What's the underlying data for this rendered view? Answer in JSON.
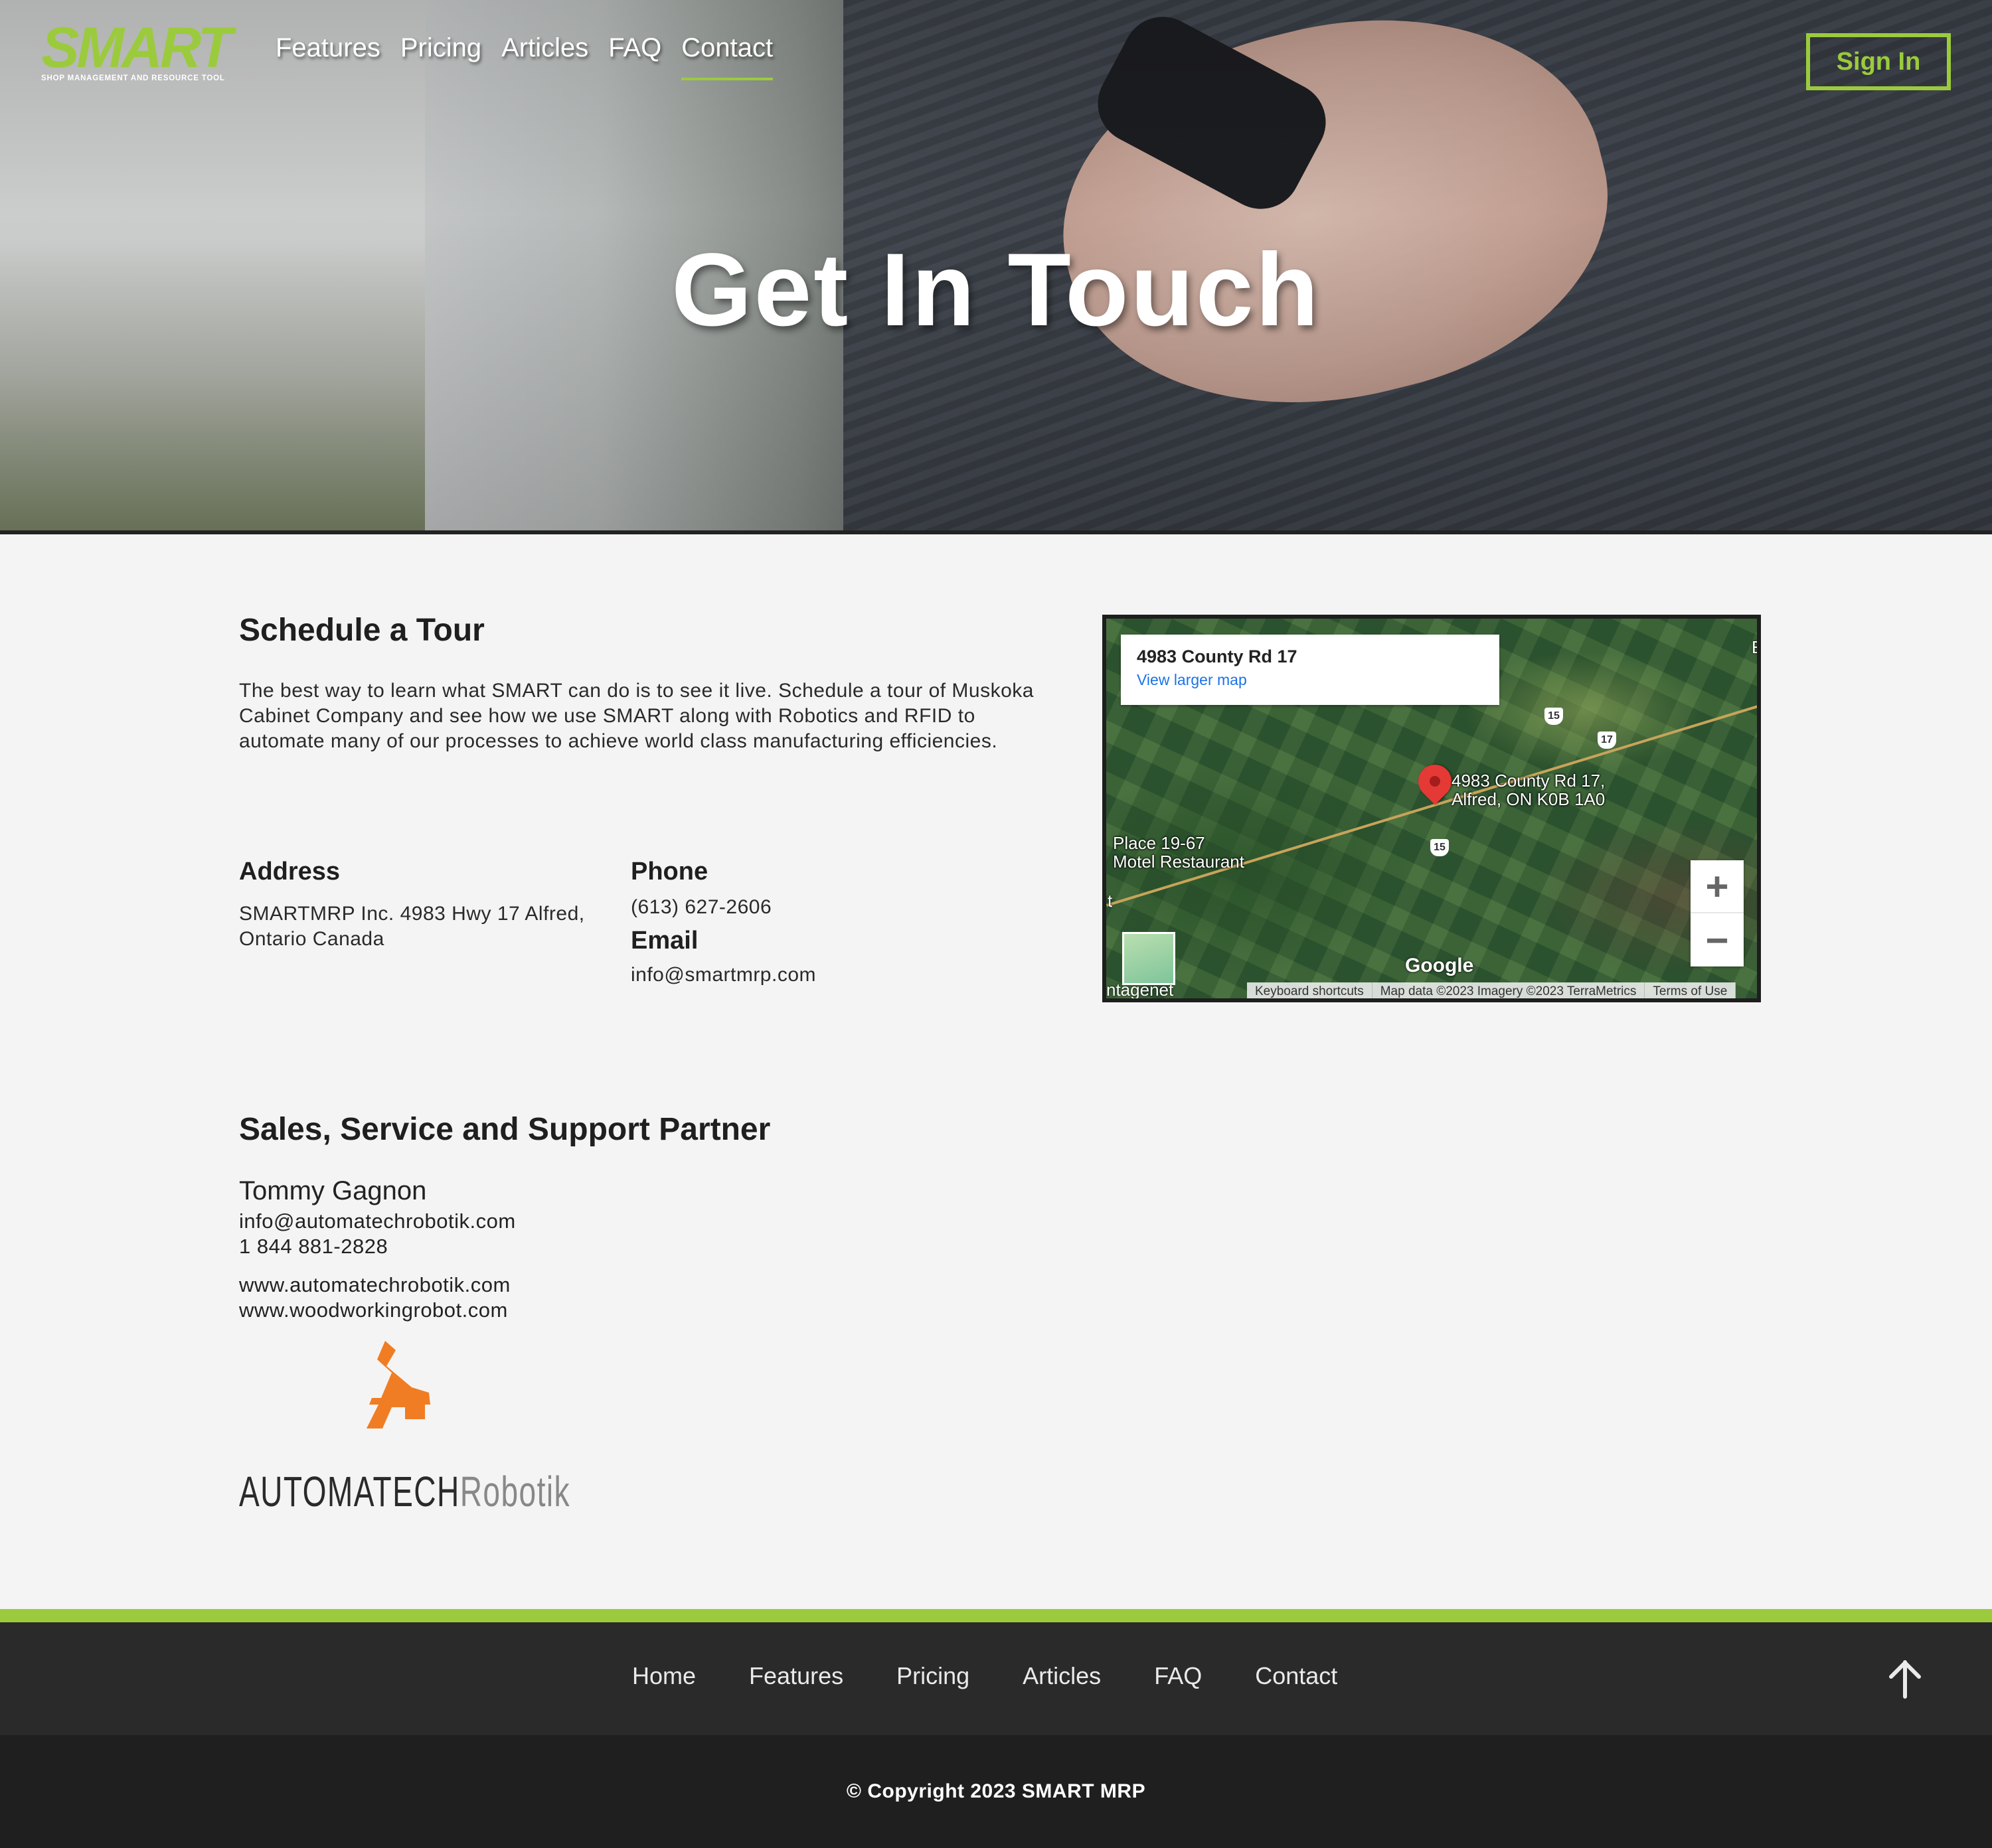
{
  "brand": {
    "logo_text": "SMART",
    "logo_tagline": "SHOP MANAGEMENT AND RESOURCE TOOL",
    "accent_color": "#9bcb3c"
  },
  "nav": {
    "items": [
      {
        "label": "Features"
      },
      {
        "label": "Pricing"
      },
      {
        "label": "Articles"
      },
      {
        "label": "FAQ"
      },
      {
        "label": "Contact",
        "active": true
      }
    ],
    "signin_label": "Sign In"
  },
  "hero": {
    "title": "Get In Touch"
  },
  "tour": {
    "title": "Schedule a Tour",
    "text": "The best way to learn what SMART can do is to see it live. Schedule a tour of Muskoka Cabinet Company and see how we use SMART along with Robotics and RFID to automate many of our processes to achieve world class manufacturing efficiencies."
  },
  "contact": {
    "address_label": "Address",
    "address_value": "SMARTMRP Inc. 4983 Hwy 17 Alfred, Ontario Canada",
    "phone_label": "Phone",
    "phone_value": "(613) 627-2606",
    "email_label": "Email",
    "email_value": "info@smartmrp.com"
  },
  "map": {
    "info_title": "4983 County Rd 17",
    "info_link": "View larger map",
    "pin_label_line1": "4983 County Rd 17,",
    "pin_label_line2": "Alfred, ON K0B 1A0",
    "place_label_line1": "Place 19-67",
    "place_label_line2": "Motel Restaurant",
    "edge_left_text": "t",
    "edge_right_text": "E",
    "bottom_left_text": "ntagenet",
    "shields": [
      "15",
      "17",
      "15"
    ],
    "zoom_in": "+",
    "zoom_out": "−",
    "google_label": "Google",
    "attrib_keyboard": "Keyboard shortcuts",
    "attrib_data": "Map data ©2023 Imagery ©2023 TerraMetrics",
    "attrib_terms": "Terms of Use"
  },
  "partner": {
    "title": "Sales, Service and Support Partner",
    "name": "Tommy Gagnon",
    "email": "info@automatechrobotik.com",
    "phone": "1 844 881-2828",
    "website1": "www.automatechrobotik.com",
    "website2": "www.woodworkingrobot.com",
    "logo_word1": "AUTOMATECH",
    "logo_word2": "Robotik",
    "logo_color": "#f07d23"
  },
  "footer": {
    "links": [
      {
        "label": "Home"
      },
      {
        "label": "Features"
      },
      {
        "label": "Pricing"
      },
      {
        "label": "Articles"
      },
      {
        "label": "FAQ"
      },
      {
        "label": "Contact"
      }
    ],
    "to_top_icon": "arrow-up-icon",
    "copyright": "© Copyright 2023 SMART MRP"
  }
}
